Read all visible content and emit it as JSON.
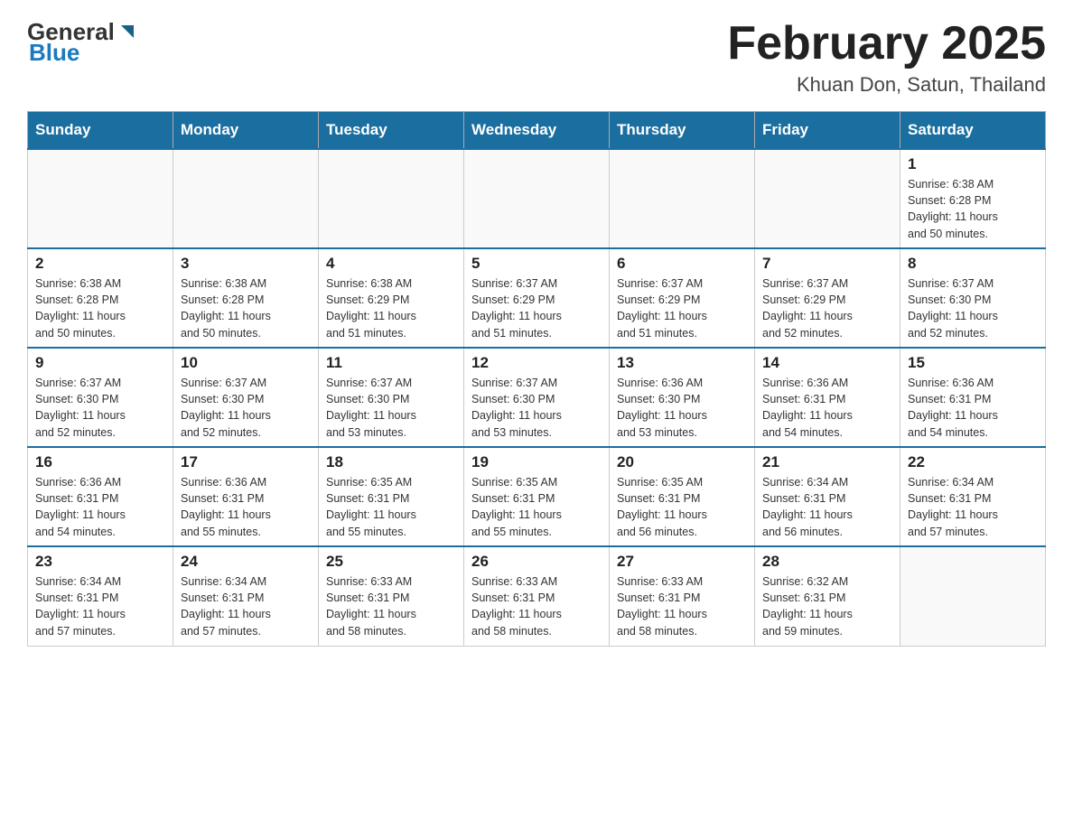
{
  "header": {
    "logo_general": "General",
    "logo_blue": "Blue",
    "month_title": "February 2025",
    "location": "Khuan Don, Satun, Thailand"
  },
  "weekdays": [
    "Sunday",
    "Monday",
    "Tuesday",
    "Wednesday",
    "Thursday",
    "Friday",
    "Saturday"
  ],
  "weeks": [
    [
      {
        "day": "",
        "info": ""
      },
      {
        "day": "",
        "info": ""
      },
      {
        "day": "",
        "info": ""
      },
      {
        "day": "",
        "info": ""
      },
      {
        "day": "",
        "info": ""
      },
      {
        "day": "",
        "info": ""
      },
      {
        "day": "1",
        "info": "Sunrise: 6:38 AM\nSunset: 6:28 PM\nDaylight: 11 hours\nand 50 minutes."
      }
    ],
    [
      {
        "day": "2",
        "info": "Sunrise: 6:38 AM\nSunset: 6:28 PM\nDaylight: 11 hours\nand 50 minutes."
      },
      {
        "day": "3",
        "info": "Sunrise: 6:38 AM\nSunset: 6:28 PM\nDaylight: 11 hours\nand 50 minutes."
      },
      {
        "day": "4",
        "info": "Sunrise: 6:38 AM\nSunset: 6:29 PM\nDaylight: 11 hours\nand 51 minutes."
      },
      {
        "day": "5",
        "info": "Sunrise: 6:37 AM\nSunset: 6:29 PM\nDaylight: 11 hours\nand 51 minutes."
      },
      {
        "day": "6",
        "info": "Sunrise: 6:37 AM\nSunset: 6:29 PM\nDaylight: 11 hours\nand 51 minutes."
      },
      {
        "day": "7",
        "info": "Sunrise: 6:37 AM\nSunset: 6:29 PM\nDaylight: 11 hours\nand 52 minutes."
      },
      {
        "day": "8",
        "info": "Sunrise: 6:37 AM\nSunset: 6:30 PM\nDaylight: 11 hours\nand 52 minutes."
      }
    ],
    [
      {
        "day": "9",
        "info": "Sunrise: 6:37 AM\nSunset: 6:30 PM\nDaylight: 11 hours\nand 52 minutes."
      },
      {
        "day": "10",
        "info": "Sunrise: 6:37 AM\nSunset: 6:30 PM\nDaylight: 11 hours\nand 52 minutes."
      },
      {
        "day": "11",
        "info": "Sunrise: 6:37 AM\nSunset: 6:30 PM\nDaylight: 11 hours\nand 53 minutes."
      },
      {
        "day": "12",
        "info": "Sunrise: 6:37 AM\nSunset: 6:30 PM\nDaylight: 11 hours\nand 53 minutes."
      },
      {
        "day": "13",
        "info": "Sunrise: 6:36 AM\nSunset: 6:30 PM\nDaylight: 11 hours\nand 53 minutes."
      },
      {
        "day": "14",
        "info": "Sunrise: 6:36 AM\nSunset: 6:31 PM\nDaylight: 11 hours\nand 54 minutes."
      },
      {
        "day": "15",
        "info": "Sunrise: 6:36 AM\nSunset: 6:31 PM\nDaylight: 11 hours\nand 54 minutes."
      }
    ],
    [
      {
        "day": "16",
        "info": "Sunrise: 6:36 AM\nSunset: 6:31 PM\nDaylight: 11 hours\nand 54 minutes."
      },
      {
        "day": "17",
        "info": "Sunrise: 6:36 AM\nSunset: 6:31 PM\nDaylight: 11 hours\nand 55 minutes."
      },
      {
        "day": "18",
        "info": "Sunrise: 6:35 AM\nSunset: 6:31 PM\nDaylight: 11 hours\nand 55 minutes."
      },
      {
        "day": "19",
        "info": "Sunrise: 6:35 AM\nSunset: 6:31 PM\nDaylight: 11 hours\nand 55 minutes."
      },
      {
        "day": "20",
        "info": "Sunrise: 6:35 AM\nSunset: 6:31 PM\nDaylight: 11 hours\nand 56 minutes."
      },
      {
        "day": "21",
        "info": "Sunrise: 6:34 AM\nSunset: 6:31 PM\nDaylight: 11 hours\nand 56 minutes."
      },
      {
        "day": "22",
        "info": "Sunrise: 6:34 AM\nSunset: 6:31 PM\nDaylight: 11 hours\nand 57 minutes."
      }
    ],
    [
      {
        "day": "23",
        "info": "Sunrise: 6:34 AM\nSunset: 6:31 PM\nDaylight: 11 hours\nand 57 minutes."
      },
      {
        "day": "24",
        "info": "Sunrise: 6:34 AM\nSunset: 6:31 PM\nDaylight: 11 hours\nand 57 minutes."
      },
      {
        "day": "25",
        "info": "Sunrise: 6:33 AM\nSunset: 6:31 PM\nDaylight: 11 hours\nand 58 minutes."
      },
      {
        "day": "26",
        "info": "Sunrise: 6:33 AM\nSunset: 6:31 PM\nDaylight: 11 hours\nand 58 minutes."
      },
      {
        "day": "27",
        "info": "Sunrise: 6:33 AM\nSunset: 6:31 PM\nDaylight: 11 hours\nand 58 minutes."
      },
      {
        "day": "28",
        "info": "Sunrise: 6:32 AM\nSunset: 6:31 PM\nDaylight: 11 hours\nand 59 minutes."
      },
      {
        "day": "",
        "info": ""
      }
    ]
  ]
}
